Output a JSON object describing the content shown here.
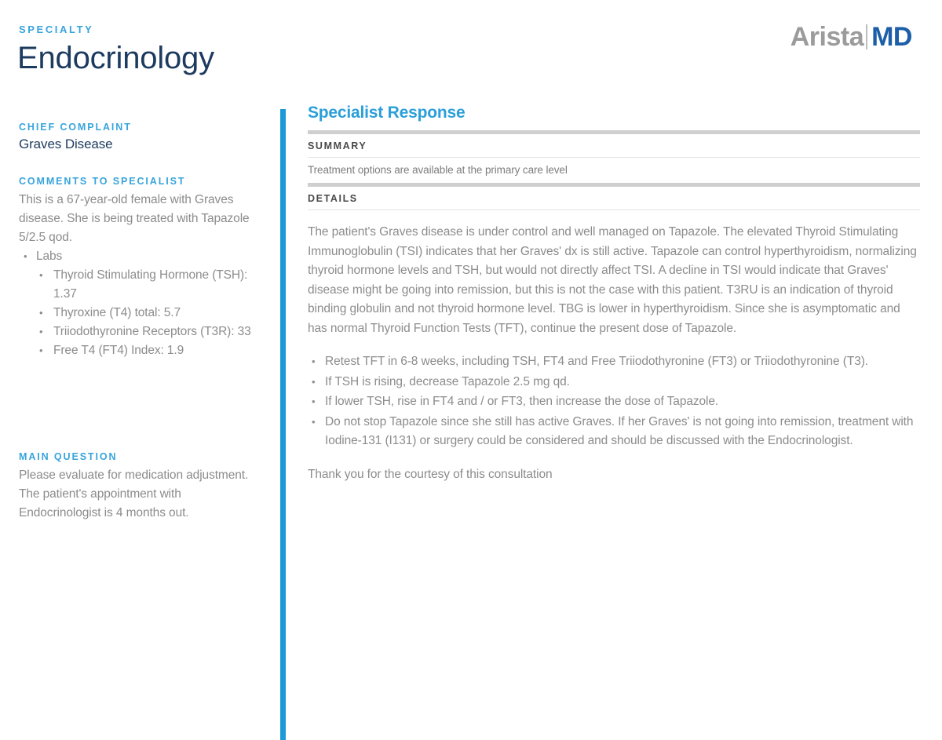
{
  "header": {
    "specialty_label": "SPECIALTY",
    "specialty_name": "Endocrinology",
    "logo_primary": "Arista",
    "logo_secondary": "MD"
  },
  "sidebar": {
    "chief_complaint_label": "CHIEF COMPLAINT",
    "chief_complaint_value": "Graves Disease",
    "comments_label": "COMMENTS TO SPECIALIST",
    "comments_intro": "This is a 67-year-old female with Graves disease. She is being treated with Tapazole 5/2.5 qod.",
    "labs_heading": "Labs",
    "labs": [
      "Thyroid Stimulating Hormone (TSH): 1.37",
      "Thyroxine (T4) total: 5.7",
      "Triiodothyronine Receptors (T3R): 33",
      "Free T4 (FT4) Index: 1.9"
    ],
    "main_question_label": "MAIN QUESTION",
    "main_question_text": "Please evaluate for medication adjustment. The patient's appointment with Endocrinologist is 4 months out."
  },
  "panel": {
    "title": "Specialist Response",
    "summary_label": "SUMMARY",
    "summary_text": "Treatment options are available at the primary care level",
    "details_label": "DETAILS",
    "details_paragraph": "The patient's Graves disease is under control and well managed on Tapazole. The elevated Thyroid Stimulating Immunoglobulin (TSI) indicates that her Graves' dx is still active. Tapazole can control hyperthyroidism, normalizing thyroid hormone levels and TSH, but would not directly affect TSI. A decline in TSI would indicate that Graves' disease might be going into remission, but this is not the case with this patient. T3RU is an indication of thyroid binding globulin and not thyroid hormone level. TBG is lower in hyperthyroidism. Since she is asymptomatic and has normal Thyroid Function Tests (TFT), continue the present dose of Tapazole.",
    "recommendations": [
      "Retest TFT in 6-8 weeks, including TSH, FT4 and Free Triiodothyronine (FT3) or Triiodothyronine (T3).",
      "If TSH is rising, decrease Tapazole 2.5 mg qd.",
      "If lower TSH, rise in FT4 and / or FT3, then increase the dose of Tapazole.",
      "Do not stop Tapazole since she still has active Graves. If her Graves' is not going into remission, treatment with Iodine-131 (I131) or surgery could be considered and should be discussed with the Endocrinologist."
    ],
    "closing": "Thank you for the courtesy of this consultation"
  },
  "colors": {
    "accent_blue": "#37A4DC",
    "panel_blue": "#2B9FD9",
    "rule_blue": "#1C9AD6",
    "navy": "#1D3A5F",
    "logo_gray": "#9B9B9B",
    "logo_blue": "#1C5FA8",
    "body_gray": "#8C8C8C"
  }
}
